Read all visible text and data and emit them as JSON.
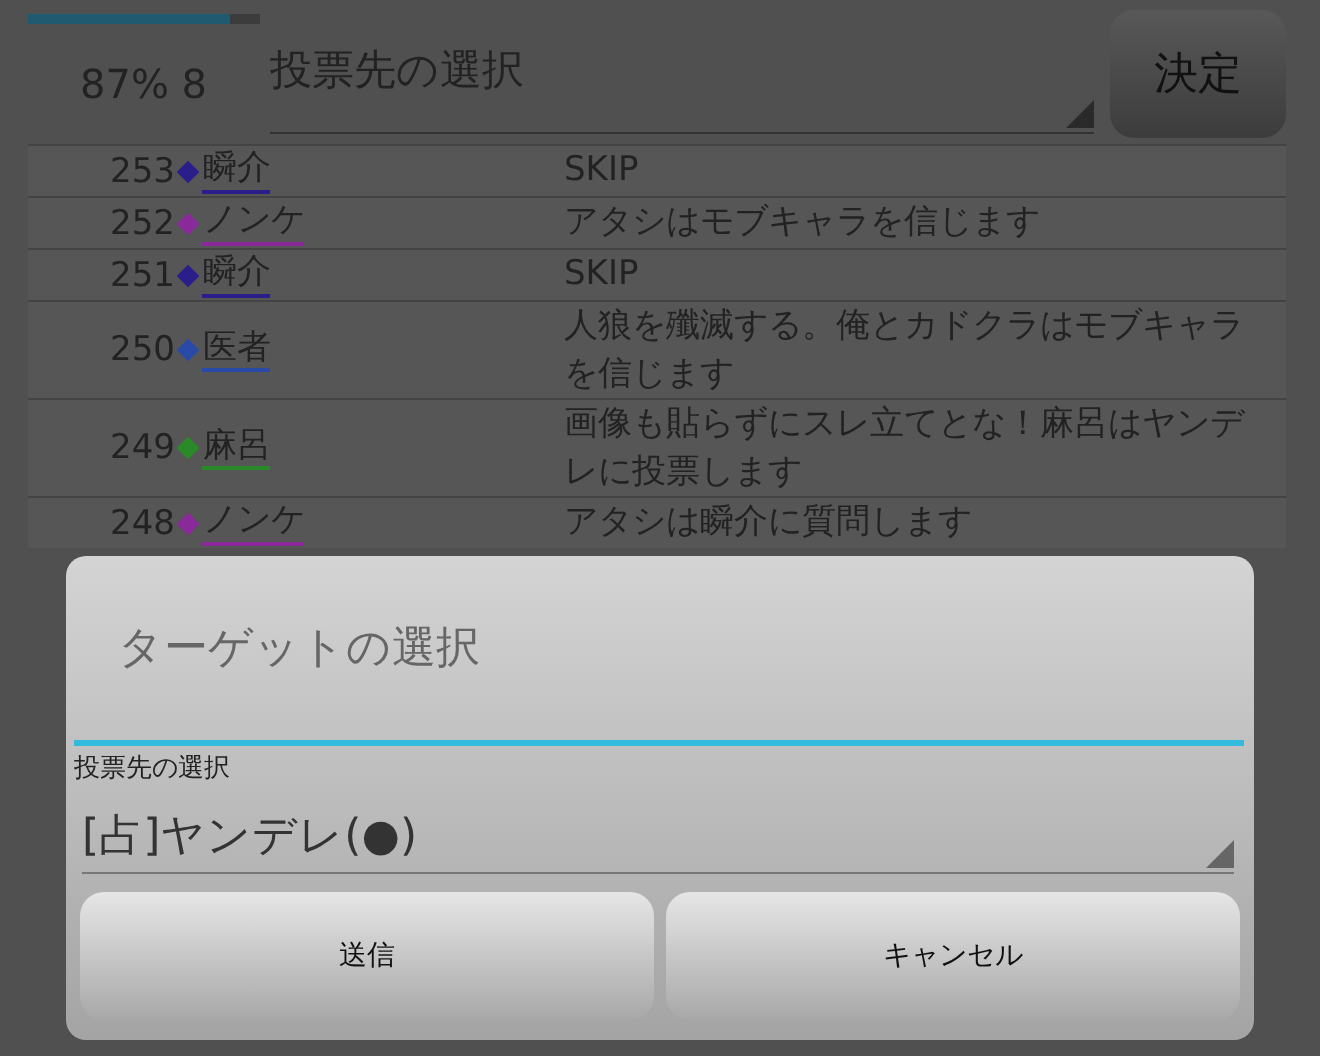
{
  "header": {
    "progress": {
      "level": 0.87
    },
    "counter": "87% 8",
    "vote_select": {
      "value": "投票先の選択"
    },
    "confirm_button": "決定"
  },
  "log": [
    {
      "number": "253",
      "name": "瞬介",
      "color": "#2a1f8a",
      "message": "SKIP"
    },
    {
      "number": "252",
      "name": "ノンケ",
      "color": "#8a2a9a",
      "message": "アタシはモブキャラを信じます"
    },
    {
      "number": "251",
      "name": "瞬介",
      "color": "#2a1f8a",
      "message": "SKIP"
    },
    {
      "number": "250",
      "name": "医者",
      "color": "#2a4aa8",
      "message": "人狼を殲滅する。俺とカドクラはモブキャラを信じます"
    },
    {
      "number": "249",
      "name": "麻呂",
      "color": "#2a8a2a",
      "message": "画像も貼らずにスレ立てとな！麻呂はヤンデレに投票します"
    },
    {
      "number": "248",
      "name": "ノンケ",
      "color": "#8a2a9a",
      "message": "アタシは瞬介に質問します"
    }
  ],
  "dialog": {
    "title_field": {
      "placeholder": "ターゲットの選択"
    },
    "label": "投票先の選択",
    "select": {
      "value": "[占]ヤンデレ(●)"
    },
    "buttons": [
      "送信",
      "キャンセル"
    ]
  }
}
